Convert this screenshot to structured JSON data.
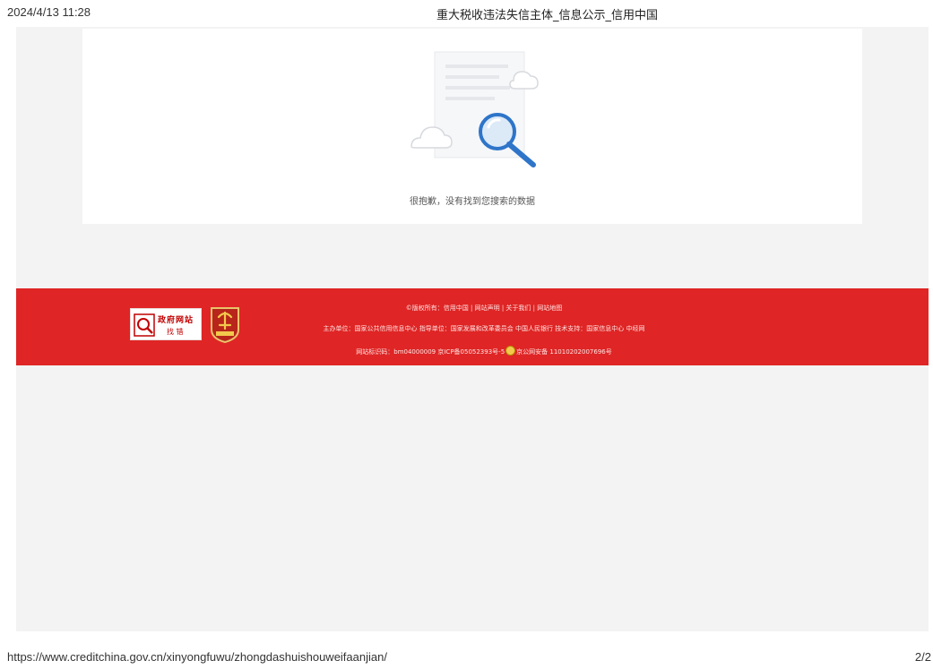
{
  "print_header": {
    "datetime": "2024/4/13 11:28",
    "title": "重大税收违法失信主体_信息公示_信用中国"
  },
  "result": {
    "empty_message": "很抱歉，没有找到您搜索的数据"
  },
  "footer": {
    "gov_badge": {
      "title": "政府网站",
      "subtitle": "找 错"
    },
    "line1": "©版权所有：信用中国 | 网站声明 | 关于我们 | 网站地图",
    "line2": "主办单位：国家公共信用信息中心  指导单位：国家发展和改革委员会 中国人民银行  技术支持：国家信息中心 中经网",
    "line3_prefix": "网站标识码：bm04000009 京ICP备05052393号-5",
    "line3_suffix": "京公网安备 11010202007696号"
  },
  "print_footer": {
    "url": "https://www.creditchina.gov.cn/xinyongfuwu/zhongdashuishouweifaanjian/",
    "page": "2/2"
  },
  "colors": {
    "footer_red": "#df2525",
    "page_background": "#f3f3f3",
    "magnifier_blue": "#2e75c9"
  },
  "icons": {
    "illustration": "document-magnifier-icon",
    "gov_badge": "gov-website-error-icon",
    "emblem": "party-emblem-icon",
    "police": "police-badge-icon"
  }
}
